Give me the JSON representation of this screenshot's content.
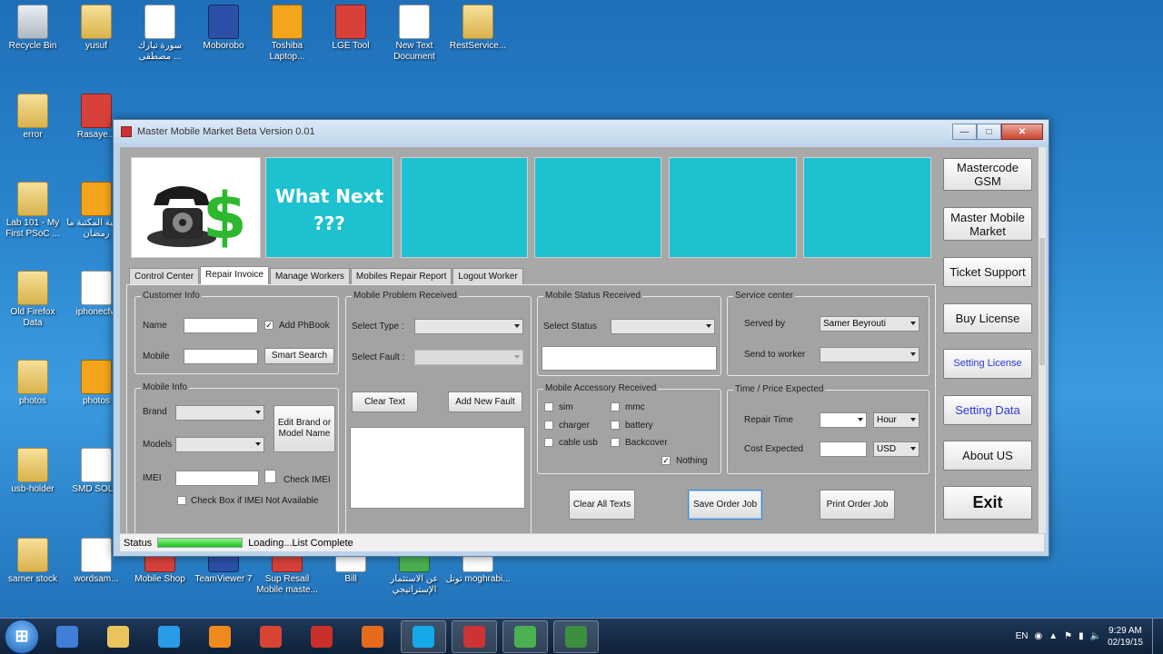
{
  "desktop": {
    "icons": [
      {
        "label": "Recycle Bin",
        "type": "bin"
      },
      {
        "label": "yusuf",
        "type": "folder"
      },
      {
        "label": "سورة تبارك مصطفى ...",
        "type": "doc"
      },
      {
        "label": "Moborobo",
        "type": "app2"
      },
      {
        "label": "Toshiba Laptop...",
        "type": "app3"
      },
      {
        "label": "LGE Tool",
        "type": "app"
      },
      {
        "label": "New Text Document",
        "type": "doc"
      },
      {
        "label": "RestService...",
        "type": "folder"
      },
      {
        "label": "error",
        "type": "folder"
      },
      {
        "label": "Rasaye...",
        "type": "app"
      },
      {
        "label": "Lab 101 - My First PSoC ...",
        "type": "folder"
      },
      {
        "label": "خلفية المكتبة ما رمضان",
        "type": "app3"
      },
      {
        "label": "Old Firefox Data",
        "type": "folder"
      },
      {
        "label": "iphonecfw",
        "type": "doc"
      },
      {
        "label": "photos",
        "type": "folder"
      },
      {
        "label": "photos",
        "type": "app3"
      },
      {
        "label": "usb-holder",
        "type": "folder"
      },
      {
        "label": "SMD SOL...",
        "type": "doc"
      },
      {
        "label": "samer stock",
        "type": "folder"
      },
      {
        "label": "wordsam...",
        "type": "doc"
      },
      {
        "label": "Mobile Shop",
        "type": "app"
      },
      {
        "label": "TeamViewer 7",
        "type": "app2"
      },
      {
        "label": "Sup Resail Mobile maste...",
        "type": "app"
      },
      {
        "label": "Bill",
        "type": "doc"
      },
      {
        "label": "عن الاستثمار الإستراتيجي",
        "type": "app4"
      },
      {
        "label": "توتل moghrabi...",
        "type": "doc"
      }
    ]
  },
  "window": {
    "title": "Master Mobile Market Beta Version 0.01",
    "min": "—",
    "max": "□",
    "close": "✕"
  },
  "banners": {
    "what_next": "What Next ???"
  },
  "side_buttons": {
    "mastercode": "Mastercode GSM",
    "master_mobile": "Master Mobile Market",
    "ticket": "Ticket Support",
    "buy": "Buy License",
    "setting_license": "Setting License",
    "setting_data": "Setting Data",
    "about": "About US",
    "exit": "Exit"
  },
  "tabs": [
    "Control Center",
    "Repair Invoice",
    "Manage Workers",
    "Mobiles Repair Report",
    "Logout Worker"
  ],
  "customer_info": {
    "title": "Customer Info",
    "name": "Name",
    "mobile": "Mobile",
    "add_phbook": "Add PhBook",
    "add_phbook_checked": true,
    "smart_search": "Smart Search"
  },
  "mobile_info": {
    "title": "Mobile Info",
    "brand": "Brand",
    "models": "Models",
    "imei": "IMEI",
    "edit_btn": "Edit Brand or Model Name",
    "check_imei": "Check IMEI",
    "not_available": "Check Box if IMEI Not Available"
  },
  "problem": {
    "title": "Mobile Problem Received",
    "select_type": "Select Type :",
    "select_fault": "Select Fault :",
    "clear_text": "Clear Text",
    "add_fault": "Add New Fault"
  },
  "status_recv": {
    "title": "Mobile Status Received",
    "select_status": "Select Status"
  },
  "accessory": {
    "title": "Mobile Accessory Received",
    "items": [
      "sim",
      "mmc",
      "charger",
      "battery",
      "cable usb",
      "Backcover"
    ],
    "nothing": "Nothing",
    "nothing_checked": true
  },
  "service": {
    "title": "Service center",
    "served_by": "Served by",
    "served_by_value": "Samer Beyrouti",
    "send_to": "Send to worker"
  },
  "time_price": {
    "title": "Time / Price Expected",
    "repair_time": "Repair Time",
    "repair_unit": "Hour",
    "cost": "Cost Expected",
    "currency": "USD"
  },
  "actions": {
    "clear_all": "Clear All Texts",
    "save": "Save Order Job",
    "print": "Print Order Job"
  },
  "status": {
    "label": "Status",
    "progress": 1.0,
    "text": "Loading...List Complete"
  },
  "taskbar": {
    "lang": "EN",
    "time": "9:29 AM",
    "date": "02/19/15",
    "apps": [
      "ie",
      "explorer",
      "ie-blue",
      "media",
      "chrome",
      "app",
      "firefox",
      "skype",
      "mobile",
      "camtasia",
      "camtasia2"
    ]
  }
}
